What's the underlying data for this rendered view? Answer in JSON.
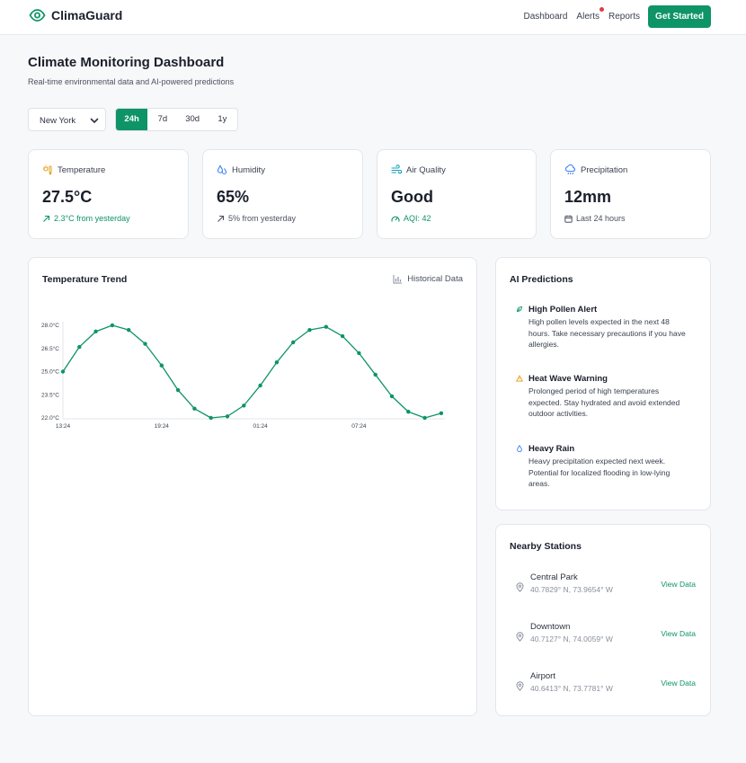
{
  "brand": {
    "name": "ClimaGuard",
    "color": "#0e9466"
  },
  "nav": {
    "links": [
      "Dashboard",
      "Alerts",
      "Reports"
    ],
    "cta": "Get Started"
  },
  "page": {
    "title": "Climate Monitoring Dashboard",
    "subtitle": "Real-time environmental data and AI-powered predictions"
  },
  "controls": {
    "location": "New York",
    "ranges": [
      "24h",
      "7d",
      "30d",
      "1y"
    ],
    "active_range": "24h"
  },
  "stats": [
    {
      "label": "Temperature",
      "icon": "sun-thermometer-icon",
      "value": "27.5°C",
      "note": "2.3°C from yesterday",
      "note_icon": "arrow-up-right-icon"
    },
    {
      "label": "Humidity",
      "icon": "droplets-icon",
      "value": "65%",
      "note": "5% from yesterday",
      "note_icon": "arrow-up-right-icon"
    },
    {
      "label": "Air Quality",
      "icon": "wind-icon",
      "value": "Good",
      "note": "AQI: 42",
      "note_icon": "gauge-icon"
    },
    {
      "label": "Precipitation",
      "icon": "cloud-rain-icon",
      "value": "12mm",
      "note": "Last 24 hours",
      "note_icon": "calendar-icon"
    }
  ],
  "trend": {
    "title": "Temperature Trend",
    "historical_label": "Historical Data"
  },
  "chart_data": {
    "type": "line",
    "x": [
      "13:24",
      "14:24",
      "15:24",
      "16:24",
      "17:24",
      "18:24",
      "19:24",
      "20:24",
      "21:24",
      "22:24",
      "23:24",
      "00:24",
      "01:24",
      "02:24",
      "03:24",
      "04:24",
      "05:24",
      "06:24",
      "07:24",
      "08:24",
      "09:24",
      "10:24",
      "11:24",
      "12:24"
    ],
    "xticks": [
      "13:24",
      "07:24",
      "01:24",
      "19:24"
    ],
    "series": [
      {
        "values": [
          25.0,
          26.6,
          27.6,
          28.0,
          27.7,
          26.8,
          25.4,
          23.8,
          22.6,
          22.0,
          22.1,
          22.8,
          24.1,
          25.6,
          26.9,
          27.7,
          27.9,
          27.3,
          26.2,
          24.8,
          23.4,
          22.4,
          22.0,
          22.3
        ]
      }
    ],
    "yticks": [
      "28.0°C",
      "26.5°C",
      "25.0°C",
      "23.5°C",
      "22.0°C"
    ],
    "ylim": [
      22.0,
      28.0
    ],
    "color": "#0e9466",
    "grid": false
  },
  "predictions": {
    "title": "AI Predictions",
    "items": [
      {
        "title": "High Pollen Alert",
        "desc": "High pollen levels expected in the next 48 hours. Take necessary precautions if you have allergies.",
        "icon": "leaf-icon",
        "color": "#0e9466"
      },
      {
        "title": "Heat Wave Warning",
        "desc": "Prolonged period of high temperatures expected. Stay hydrated and avoid extended outdoor activities.",
        "icon": "warning-icon",
        "color": "#e5a11a"
      },
      {
        "title": "Heavy Rain",
        "desc": "Heavy precipitation expected next week. Potential for localized flooding in low-lying areas.",
        "icon": "raindrop-icon",
        "color": "#3b82f6"
      }
    ]
  },
  "stations": {
    "title": "Nearby Stations",
    "view_label": "View Data",
    "items": [
      {
        "name": "Central Park",
        "coords": "40.7829° N, 73.9654° W"
      },
      {
        "name": "Downtown",
        "coords": "40.7127° N, 74.0059° W"
      },
      {
        "name": "Airport",
        "coords": "40.6413° N, 73.7781° W"
      }
    ]
  }
}
